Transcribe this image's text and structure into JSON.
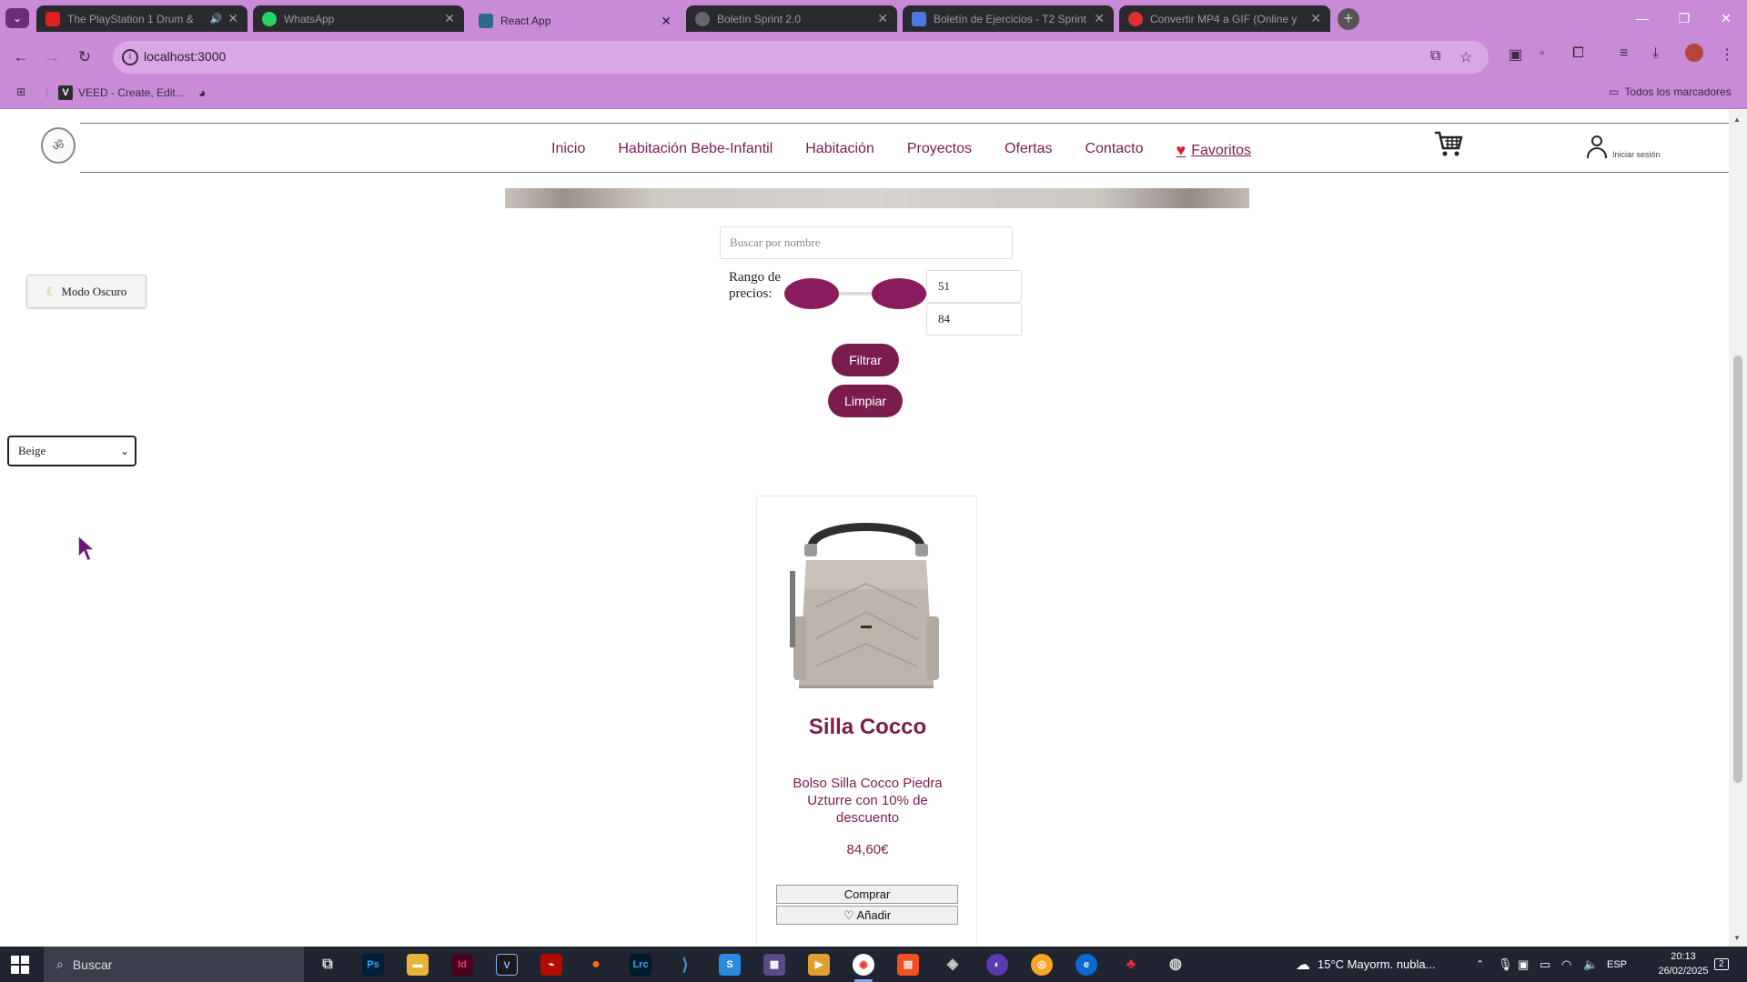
{
  "browser": {
    "tabs": [
      {
        "title": "The PlayStation 1 Drum &",
        "favicon_color": "#e02020"
      },
      {
        "title": "WhatsApp",
        "favicon_color": "#25d366"
      },
      {
        "title": "React App",
        "favicon_color": "#2a6a8a"
      },
      {
        "title": "Boletín Sprint 2.0",
        "favicon_color": "#666666"
      },
      {
        "title": "Boletín de Ejercicios - T2 Sprint",
        "favicon_color": "#4a7ae0"
      },
      {
        "title": "Convertir MP4 a GIF (Online y",
        "favicon_color": "#e03030"
      }
    ],
    "active_tab_index": 2,
    "url": "localhost:3000",
    "bookmarks": [
      {
        "label": "VEED - Create, Edit..."
      }
    ],
    "all_bookmarks_label": "Todos los marcadores",
    "accent_color": "#c98ad8"
  },
  "site": {
    "nav": [
      {
        "label": "Inicio"
      },
      {
        "label": "Habitación Bebe-Infantil"
      },
      {
        "label": "Habitación"
      },
      {
        "label": "Proyectos"
      },
      {
        "label": "Ofertas"
      },
      {
        "label": "Contacto"
      }
    ],
    "favorites_label": "Favoritos",
    "login_label": "Iniciar sesión",
    "brand_color": "#7a1d4e"
  },
  "controls": {
    "dark_mode_label": "Modo Oscuro",
    "color_filter_value": "Beige",
    "search_placeholder": "Buscar por nombre",
    "price_range_label": "Rango de precios:",
    "price_min": "51",
    "price_max": "84",
    "filter_label": "Filtrar",
    "clear_label": "Limpiar"
  },
  "product": {
    "title": "Silla Cocco",
    "description": "Bolso Silla Cocco Piedra Uzturre con 10% de descuento",
    "price": "84,60€",
    "buy_label": "Comprar",
    "add_label": "Añadir"
  },
  "taskbar": {
    "search_label": "Buscar",
    "weather": "15°C  Mayorm. nubla...",
    "language": "ESP",
    "time": "20:13",
    "date": "26/02/2025",
    "notifications": "2"
  }
}
